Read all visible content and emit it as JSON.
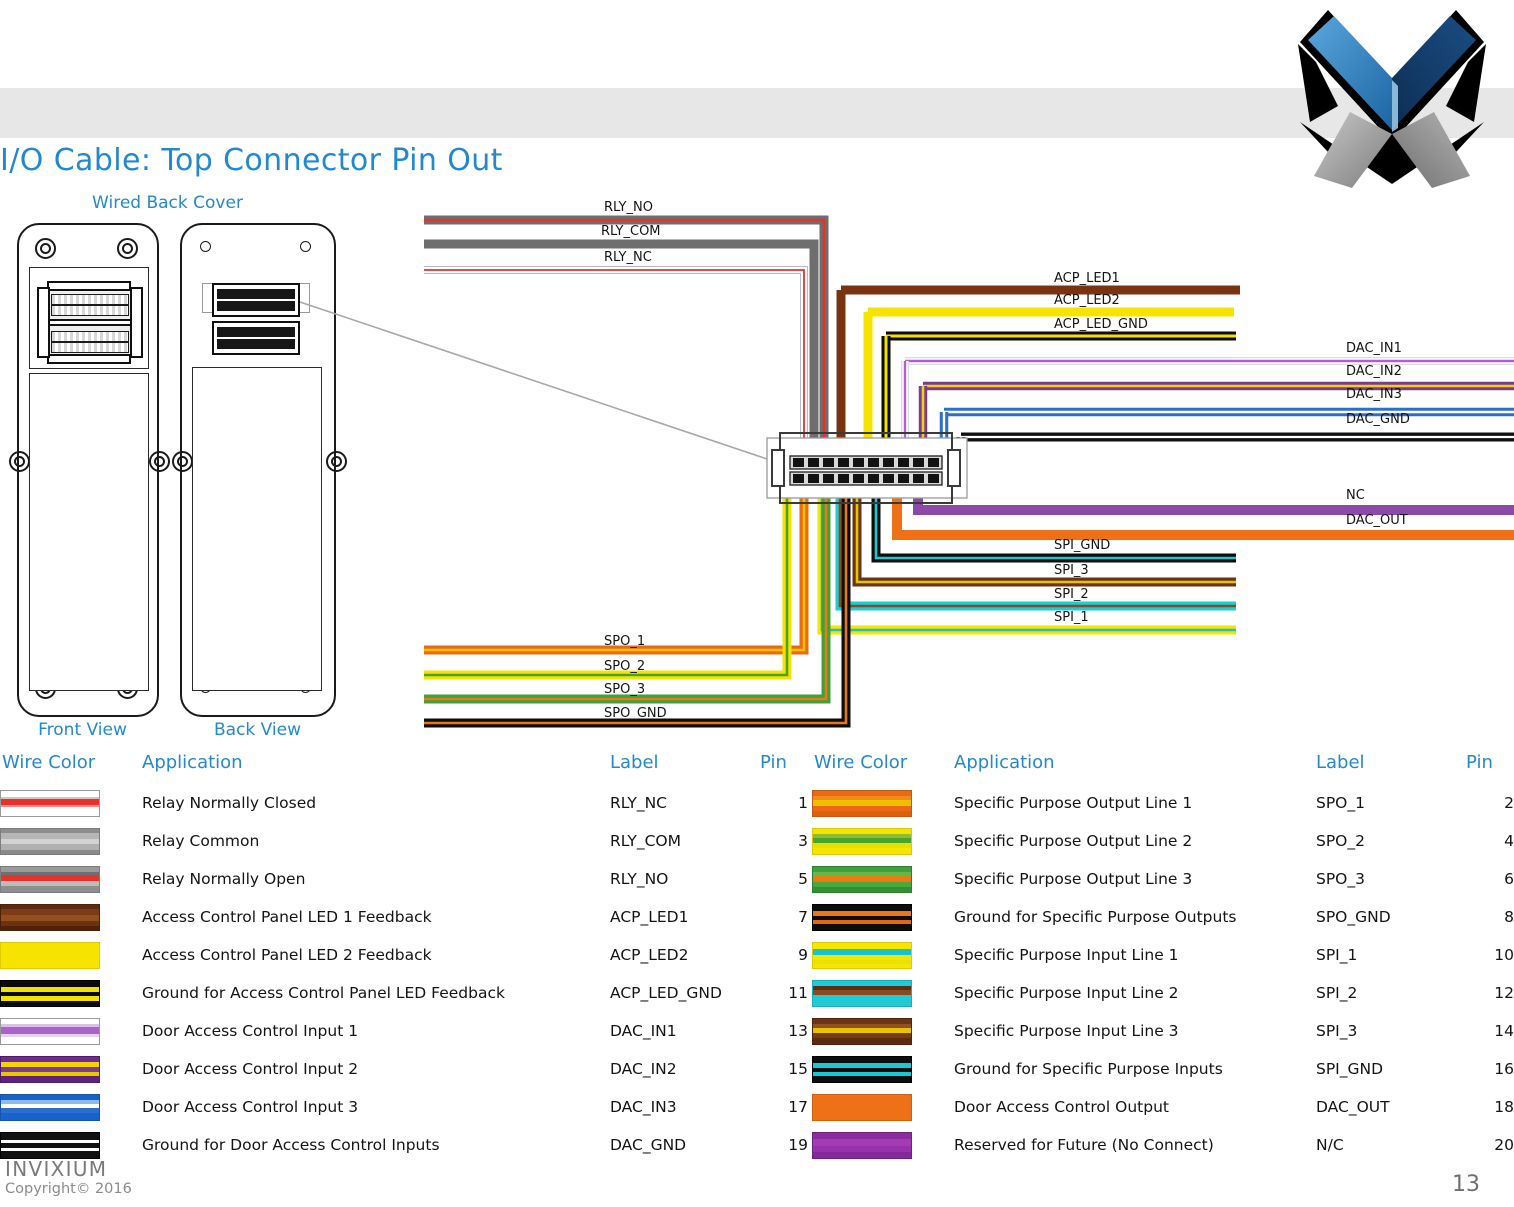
{
  "page_title": "I/O Cable: Top Connector Pin Out",
  "device": {
    "group_label": "Wired Back Cover",
    "front_view_label": "Front View",
    "back_view_label": "Back View"
  },
  "diagram": {
    "wire_labels_top_left": [
      "RLY_NO",
      "RLY_COM",
      "RLY_NC"
    ],
    "wire_labels_mid_left": [
      "ACP_LED1",
      "ACP_LED2",
      "ACP_LED_GND"
    ],
    "wire_labels_right_top": [
      "DAC_IN1",
      "DAC_IN2",
      "DAC_IN3",
      "DAC_GND"
    ],
    "wire_labels_right_bottom": [
      "NC",
      "DAC_OUT"
    ],
    "wire_labels_mid_lower": [
      "SPI_GND",
      "SPI_3",
      "SPI_2",
      "SPI_1"
    ],
    "wire_labels_bottom_left": [
      "SPO_1",
      "SPO_2",
      "SPO_3",
      "SPO_GND"
    ]
  },
  "table_headers": {
    "wire_color": "Wire Color",
    "application": "Application",
    "label": "Label",
    "pin": "Pin"
  },
  "table_left": [
    {
      "application": "Relay Normally Closed",
      "label": "RLY_NC",
      "pin": "1",
      "stripes": [
        [
          "#ffffff",
          6
        ],
        [
          "#c9c9c9",
          2
        ],
        [
          "#e8312a",
          6
        ],
        [
          "#f58b86",
          2
        ],
        [
          "#ffffff",
          9
        ]
      ],
      "border": "#9a9a9a"
    },
    {
      "application": "Relay Common",
      "label": "RLY_COM",
      "pin": "3",
      "stripes": [
        [
          "#8d8d8d",
          4
        ],
        [
          "#b6b6b6",
          6
        ],
        [
          "#d2d2d2",
          5
        ],
        [
          "#b0b0b0",
          6
        ],
        [
          "#8a8a8a",
          4
        ]
      ],
      "border": "#7d7d7d"
    },
    {
      "application": "Relay Normally Open",
      "label": "RLY_NO",
      "pin": "5",
      "stripes": [
        [
          "#9b9b9b",
          5
        ],
        [
          "#6f6f6f",
          3
        ],
        [
          "#e8312a",
          6
        ],
        [
          "#bdbdbd",
          5
        ],
        [
          "#8e8e8e",
          6
        ]
      ],
      "border": "#7d7d7d"
    },
    {
      "application": "Access Control Panel LED 1 Feedback",
      "label": "ACP_LED1",
      "pin": "7",
      "stripes": [
        [
          "#5d2a10",
          4
        ],
        [
          "#7d3c17",
          6
        ],
        [
          "#93501f",
          6
        ],
        [
          "#6d320f",
          5
        ],
        [
          "#4e2309",
          4
        ]
      ],
      "border": "#4a2109"
    },
    {
      "application": "Access Control Panel LED 2 Feedback",
      "label": "ACP_LED2",
      "pin": "9",
      "stripes": [
        [
          "#f6e400",
          25
        ]
      ],
      "border": "#ddcc00"
    },
    {
      "application": "Ground for Access Control Panel LED Feedback",
      "label": "ACP_LED_GND",
      "pin": "11",
      "stripes": [
        [
          "#0b0b0b",
          6
        ],
        [
          "#f3e200",
          5
        ],
        [
          "#0b0b0b",
          4
        ],
        [
          "#f3e200",
          5
        ],
        [
          "#0b0b0b",
          5
        ]
      ],
      "border": "#000000"
    },
    {
      "application": "Door Access Control Input 1",
      "label": "DAC_IN1",
      "pin": "13",
      "stripes": [
        [
          "#ffffff",
          5
        ],
        [
          "#d9c2e6",
          3
        ],
        [
          "#a963c9",
          7
        ],
        [
          "#e4d3ee",
          3
        ],
        [
          "#ffffff",
          7
        ]
      ],
      "border": "#9a9a9a"
    },
    {
      "application": "Door Access Control Input 2",
      "label": "DAC_IN2",
      "pin": "15",
      "stripes": [
        [
          "#6d2c8f",
          5
        ],
        [
          "#f3d400",
          5
        ],
        [
          "#7a3a9c",
          5
        ],
        [
          "#e8c800",
          4
        ],
        [
          "#5e2180",
          6
        ]
      ],
      "border": "#4d1a6b"
    },
    {
      "application": "Door Access Control Input 3",
      "label": "DAC_IN3",
      "pin": "17",
      "stripes": [
        [
          "#1763c9",
          5
        ],
        [
          "#8ebbe8",
          4
        ],
        [
          "#ffffff",
          4
        ],
        [
          "#2a6fd0",
          5
        ],
        [
          "#1763c9",
          7
        ]
      ],
      "border": "#1456ad"
    },
    {
      "application": "Ground for Door Access Control Inputs",
      "label": "DAC_GND",
      "pin": "19",
      "stripes": [
        [
          "#111111",
          7
        ],
        [
          "#ffffff",
          3
        ],
        [
          "#111111",
          5
        ],
        [
          "#ffffff",
          3
        ],
        [
          "#111111",
          7
        ]
      ],
      "border": "#000000"
    }
  ],
  "table_right": [
    {
      "application": "Specific Purpose Output Line 1",
      "label": "SPO_1",
      "pin": "2",
      "stripes": [
        [
          "#ea6a14",
          5
        ],
        [
          "#f08a1c",
          4
        ],
        [
          "#f0c000",
          6
        ],
        [
          "#ea6a14",
          5
        ],
        [
          "#e05e0c",
          5
        ]
      ],
      "border": "#c8560c"
    },
    {
      "application": "Specific Purpose Output Line 2",
      "label": "SPO_2",
      "pin": "4",
      "stripes": [
        [
          "#f5e400",
          5
        ],
        [
          "#8dbb3a",
          4
        ],
        [
          "#4aa32a",
          5
        ],
        [
          "#eadd00",
          5
        ],
        [
          "#f5e400",
          6
        ]
      ],
      "border": "#d8cc00"
    },
    {
      "application": "Specific Purpose Output Line 3",
      "label": "SPO_3",
      "pin": "6",
      "stripes": [
        [
          "#3ea13a",
          5
        ],
        [
          "#62b946",
          4
        ],
        [
          "#ea7a18",
          6
        ],
        [
          "#47a93c",
          5
        ],
        [
          "#2f9132",
          5
        ]
      ],
      "border": "#2c8030"
    },
    {
      "application": "Ground for Specific Purpose Outputs",
      "label": "SPO_GND",
      "pin": "8",
      "stripes": [
        [
          "#0d0d0d",
          6
        ],
        [
          "#e8761a",
          5
        ],
        [
          "#0d0d0d",
          4
        ],
        [
          "#e06a12",
          4
        ],
        [
          "#0d0d0d",
          6
        ]
      ],
      "border": "#000000"
    },
    {
      "application": "Specific Purpose Input Line 1",
      "label": "SPI_1",
      "pin": "10",
      "stripes": [
        [
          "#f6e500",
          6
        ],
        [
          "#16c4cf",
          6
        ],
        [
          "#f6e500",
          5
        ],
        [
          "#ece000",
          4
        ],
        [
          "#f6e500",
          4
        ]
      ],
      "border": "#ddcc00"
    },
    {
      "application": "Specific Purpose Input Line 2",
      "label": "SPI_2",
      "pin": "12",
      "stripes": [
        [
          "#1ccdd6",
          5
        ],
        [
          "#5c2f14",
          4
        ],
        [
          "#8a4a20",
          5
        ],
        [
          "#1ccdd6",
          5
        ],
        [
          "#23c9d2",
          6
        ]
      ],
      "border": "#16b0b8"
    },
    {
      "application": "Specific Purpose Input Line 3",
      "label": "SPI_3",
      "pin": "14",
      "stripes": [
        [
          "#6b3414",
          5
        ],
        [
          "#8f5220",
          4
        ],
        [
          "#e8c400",
          5
        ],
        [
          "#7a3c17",
          5
        ],
        [
          "#5e2a0f",
          6
        ]
      ],
      "border": "#4f2209"
    },
    {
      "application": "Ground for Specific Purpose Inputs",
      "label": "SPI_GND",
      "pin": "16",
      "stripes": [
        [
          "#0d0d0d",
          6
        ],
        [
          "#18c8d2",
          5
        ],
        [
          "#0d0d0d",
          4
        ],
        [
          "#18c8d2",
          4
        ],
        [
          "#0d0d0d",
          6
        ]
      ],
      "border": "#000000"
    },
    {
      "application": "Door Access Control Output",
      "label": "DAC_OUT",
      "pin": "18",
      "stripes": [
        [
          "#ee7117",
          25
        ]
      ],
      "border": "#d2600c"
    },
    {
      "application": "Reserved for Future (No Connect)",
      "label": "N/C",
      "pin": "20",
      "stripes": [
        [
          "#8b2d9e",
          6
        ],
        [
          "#a23bb4",
          7
        ],
        [
          "#9733aa",
          6
        ],
        [
          "#83299a",
          6
        ]
      ],
      "border": "#701f82"
    }
  ],
  "footer": {
    "brand": "INVIXIUM",
    "copyright": "Copyright© 2016",
    "page_number": "13"
  }
}
